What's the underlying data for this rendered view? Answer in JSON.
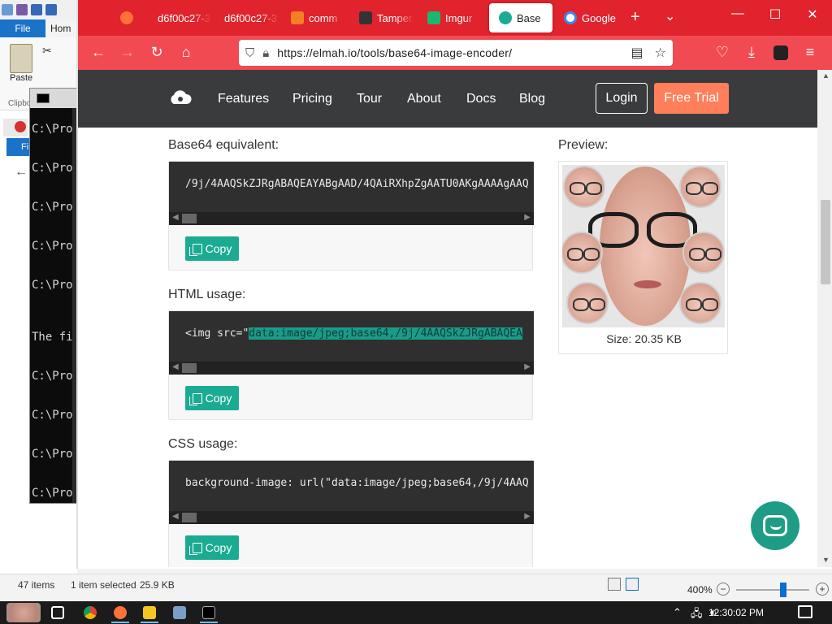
{
  "explorer": {
    "file_tab": "File",
    "home_tab": "Hom",
    "paste_label": "Paste",
    "clipboard_label": "Clipbo",
    "file_tab2": "Fi",
    "status_items": "47 items",
    "status_selected": "1 item selected",
    "status_size": "25.9 KB",
    "zoom_level": "400%"
  },
  "cmd": {
    "lines": [
      "C:\\Prog",
      "C:\\Prog",
      "C:\\Prog",
      "C:\\Prog",
      "C:\\Prog",
      "The fil",
      "C:\\Prog",
      "C:\\Prog",
      "C:\\Prog",
      "C:\\Prog"
    ]
  },
  "browser": {
    "tabs": [
      {
        "label": "",
        "favicon": "firefox-icon",
        "color": "#ff7139"
      },
      {
        "label": "d6f00c27-3",
        "favicon": "",
        "color": ""
      },
      {
        "label": "d6f00c27-3",
        "favicon": "",
        "color": ""
      },
      {
        "label": "comm",
        "favicon": "stackoverflow-icon",
        "color": "#f48024"
      },
      {
        "label": "Tamper",
        "favicon": "tampermonkey-icon",
        "color": "#333333"
      },
      {
        "label": "Imgur",
        "favicon": "imgur-icon",
        "color": "#1bb76e"
      },
      {
        "label": "Base",
        "favicon": "elmah-icon",
        "color": "#1bab92"
      },
      {
        "label": "Google",
        "favicon": "google-icon",
        "color": "#4285f4"
      }
    ],
    "url": "https://elmah.io/tools/base64-image-encoder/"
  },
  "site": {
    "nav": [
      "Features",
      "Pricing",
      "Tour",
      "About",
      "Docs",
      "Blog"
    ],
    "login": "Login",
    "free_trial": "Free Trial",
    "accent": "#1bab92",
    "trial_color": "#ff7f5a"
  },
  "sections": {
    "base64": {
      "label": "Base64 equivalent:",
      "code": "/9j/4AAQSkZJRgABAQEAYABgAAD/4QAiRXhpZgAATU0AKgAAAAgAAQ",
      "copy": "Copy"
    },
    "html": {
      "label": "HTML usage:",
      "code_prefix": "<img src=\"",
      "code_selected": "data:image/jpeg;base64,/9j/4AAQSkZJRgABAQEA",
      "copy": "Copy"
    },
    "css": {
      "label": "CSS usage:",
      "code": "background-image: url(\"data:image/jpeg;base64,/9j/4AAQ",
      "copy": "Copy"
    }
  },
  "preview": {
    "label": "Preview:",
    "size": "Size: 20.35 KB"
  },
  "taskbar": {
    "clock": "12:30:02 PM"
  }
}
